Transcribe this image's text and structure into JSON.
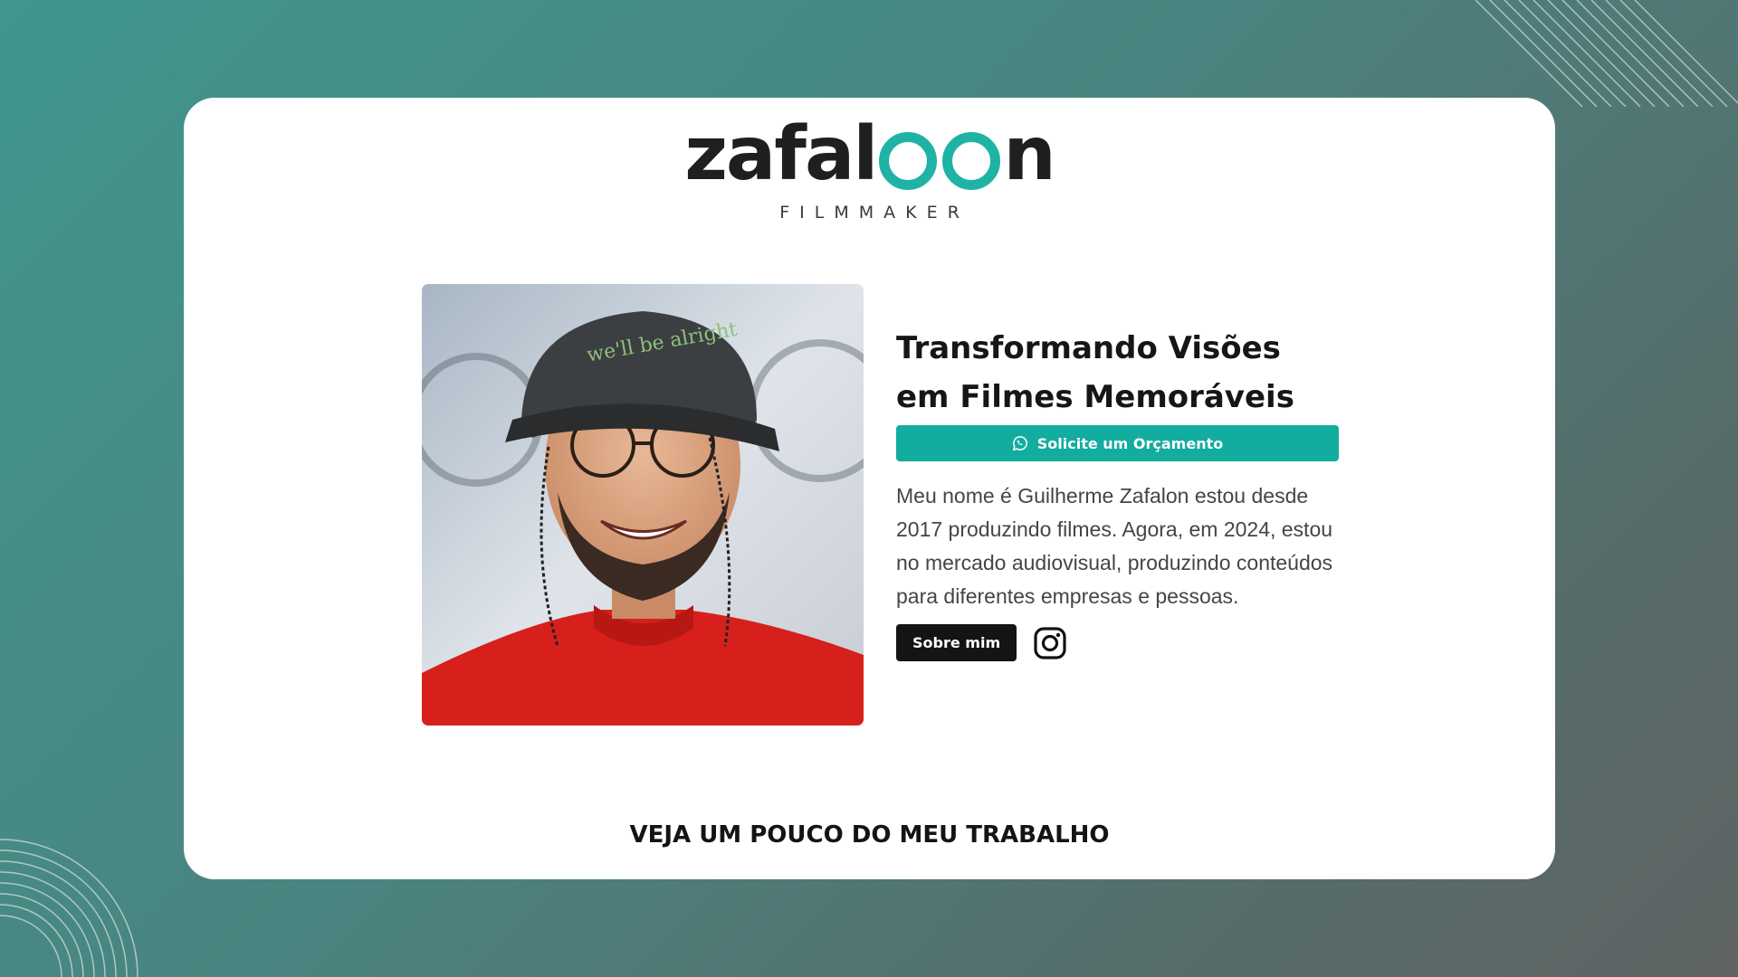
{
  "brand": {
    "name_prefix": "zafal",
    "name_suffix": "n",
    "tagline": "FILMMAKER",
    "accent_color": "#1fb3a6"
  },
  "hero": {
    "headline": "Transformando Visões em Filmes Memoráveis",
    "cta_label": "Solicite um Orçamento",
    "cta_icon": "whatsapp-icon",
    "bio": "Meu nome é Guilherme Zafalon estou desde 2017 produzindo filmes. Agora, em 2024, estou no mercado audiovisual, produzindo conteúdos para diferentes empresas e pessoas.",
    "about_label": "Sobre mim",
    "social_icon": "instagram-icon",
    "photo_cap_text": "we'll be alright"
  },
  "section": {
    "title": "VEJA UM POUCO DO MEU TRABALHO"
  }
}
